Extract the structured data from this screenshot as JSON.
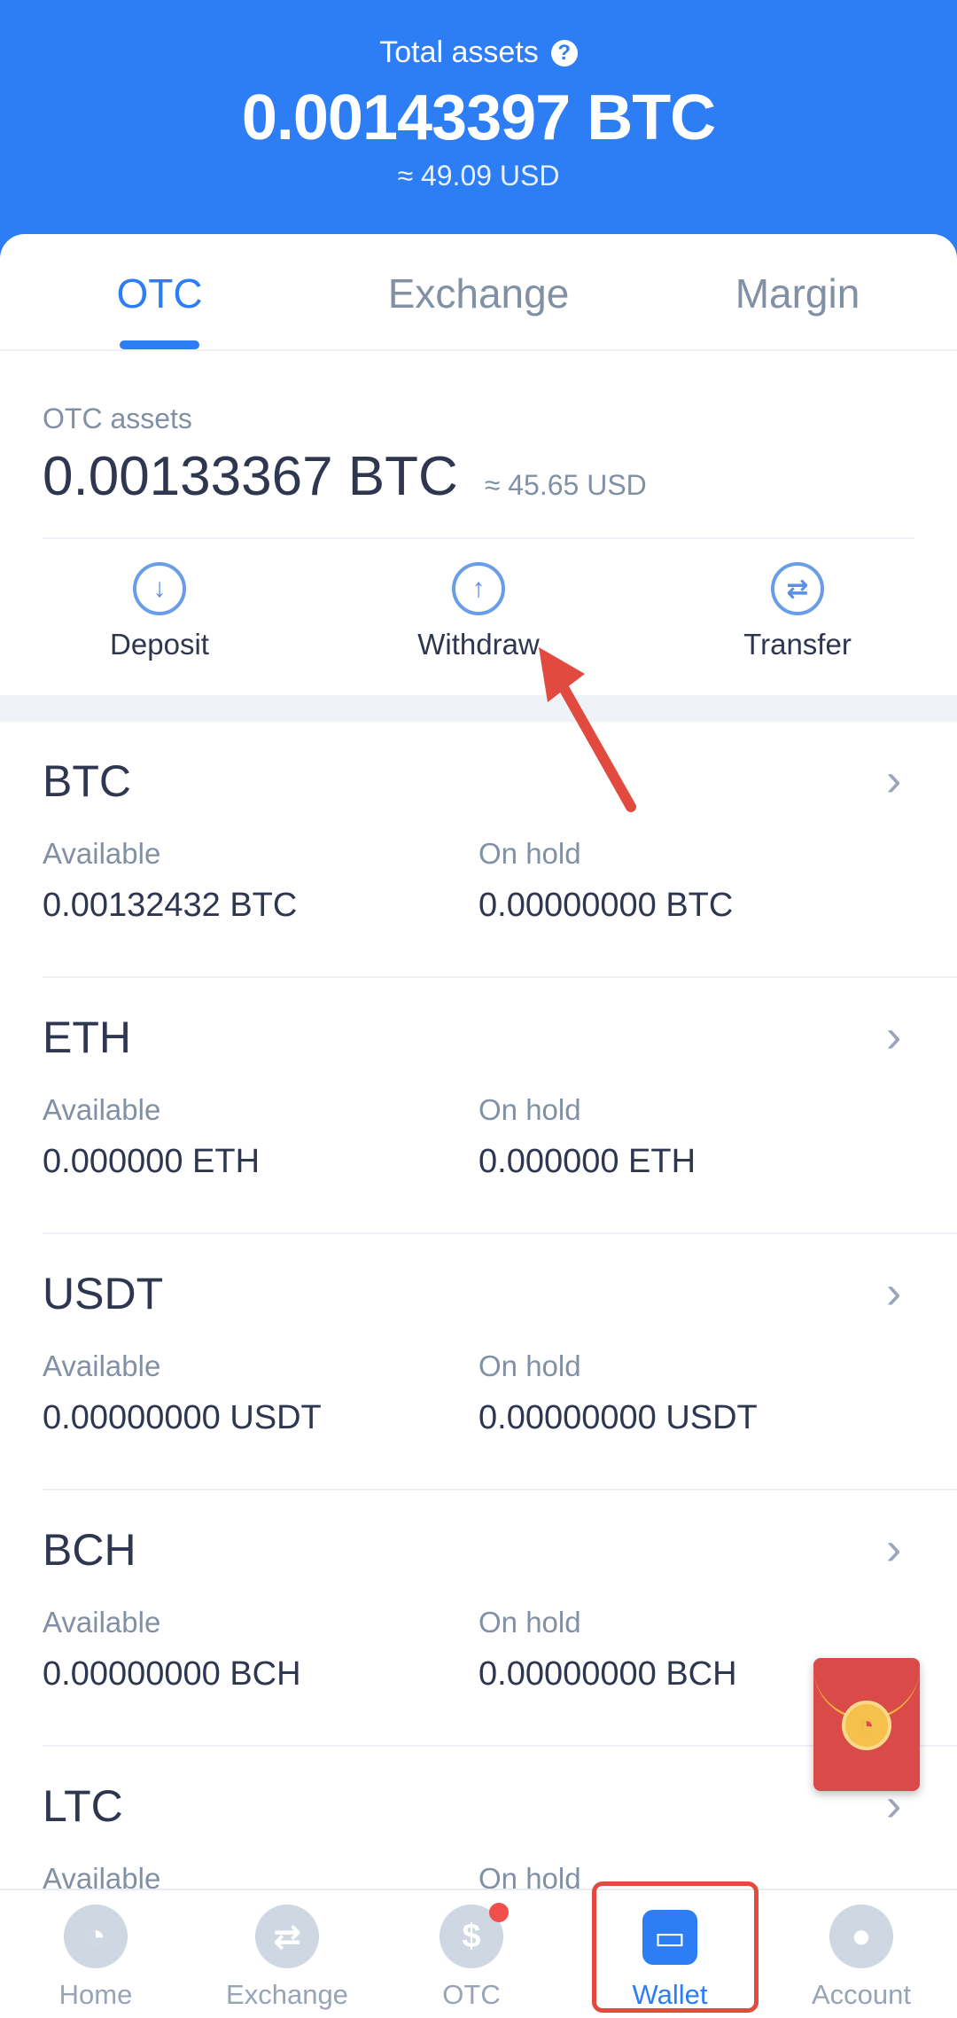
{
  "header": {
    "total_label": "Total assets",
    "total_btc": "0.00143397 BTC",
    "total_usd": "≈ 49.09 USD"
  },
  "tabs": [
    {
      "label": "OTC",
      "active": true
    },
    {
      "label": "Exchange",
      "active": false
    },
    {
      "label": "Margin",
      "active": false
    }
  ],
  "otc": {
    "label": "OTC assets",
    "btc": "0.00133367 BTC",
    "usd": "≈ 45.65 USD"
  },
  "actions": [
    {
      "label": "Deposit",
      "icon": "arrow-down-circle-icon"
    },
    {
      "label": "Withdraw",
      "icon": "arrow-up-circle-icon"
    },
    {
      "label": "Transfer",
      "icon": "transfer-circle-icon"
    }
  ],
  "coins": [
    {
      "name": "BTC",
      "available_label": "Available",
      "available": "0.00132432 BTC",
      "onhold_label": "On hold",
      "onhold": "0.00000000 BTC"
    },
    {
      "name": "ETH",
      "available_label": "Available",
      "available": "0.000000 ETH",
      "onhold_label": "On hold",
      "onhold": "0.000000 ETH"
    },
    {
      "name": "USDT",
      "available_label": "Available",
      "available": "0.00000000 USDT",
      "onhold_label": "On hold",
      "onhold": "0.00000000 USDT"
    },
    {
      "name": "BCH",
      "available_label": "Available",
      "available": "0.00000000 BCH",
      "onhold_label": "On hold",
      "onhold": "0.00000000 BCH"
    },
    {
      "name": "LTC",
      "available_label": "Available",
      "available": "",
      "onhold_label": "On hold",
      "onhold": ""
    }
  ],
  "tabbar": [
    {
      "label": "Home",
      "icon": "home-icon"
    },
    {
      "label": "Exchange",
      "icon": "exchange-icon"
    },
    {
      "label": "OTC",
      "icon": "dollar-icon",
      "notification": true
    },
    {
      "label": "Wallet",
      "icon": "wallet-icon",
      "active": true
    },
    {
      "label": "Account",
      "icon": "account-icon"
    }
  ],
  "colors": {
    "primary": "#2d7df5",
    "annotation": "#e24a3f",
    "red_envelope": "#d94a48"
  }
}
